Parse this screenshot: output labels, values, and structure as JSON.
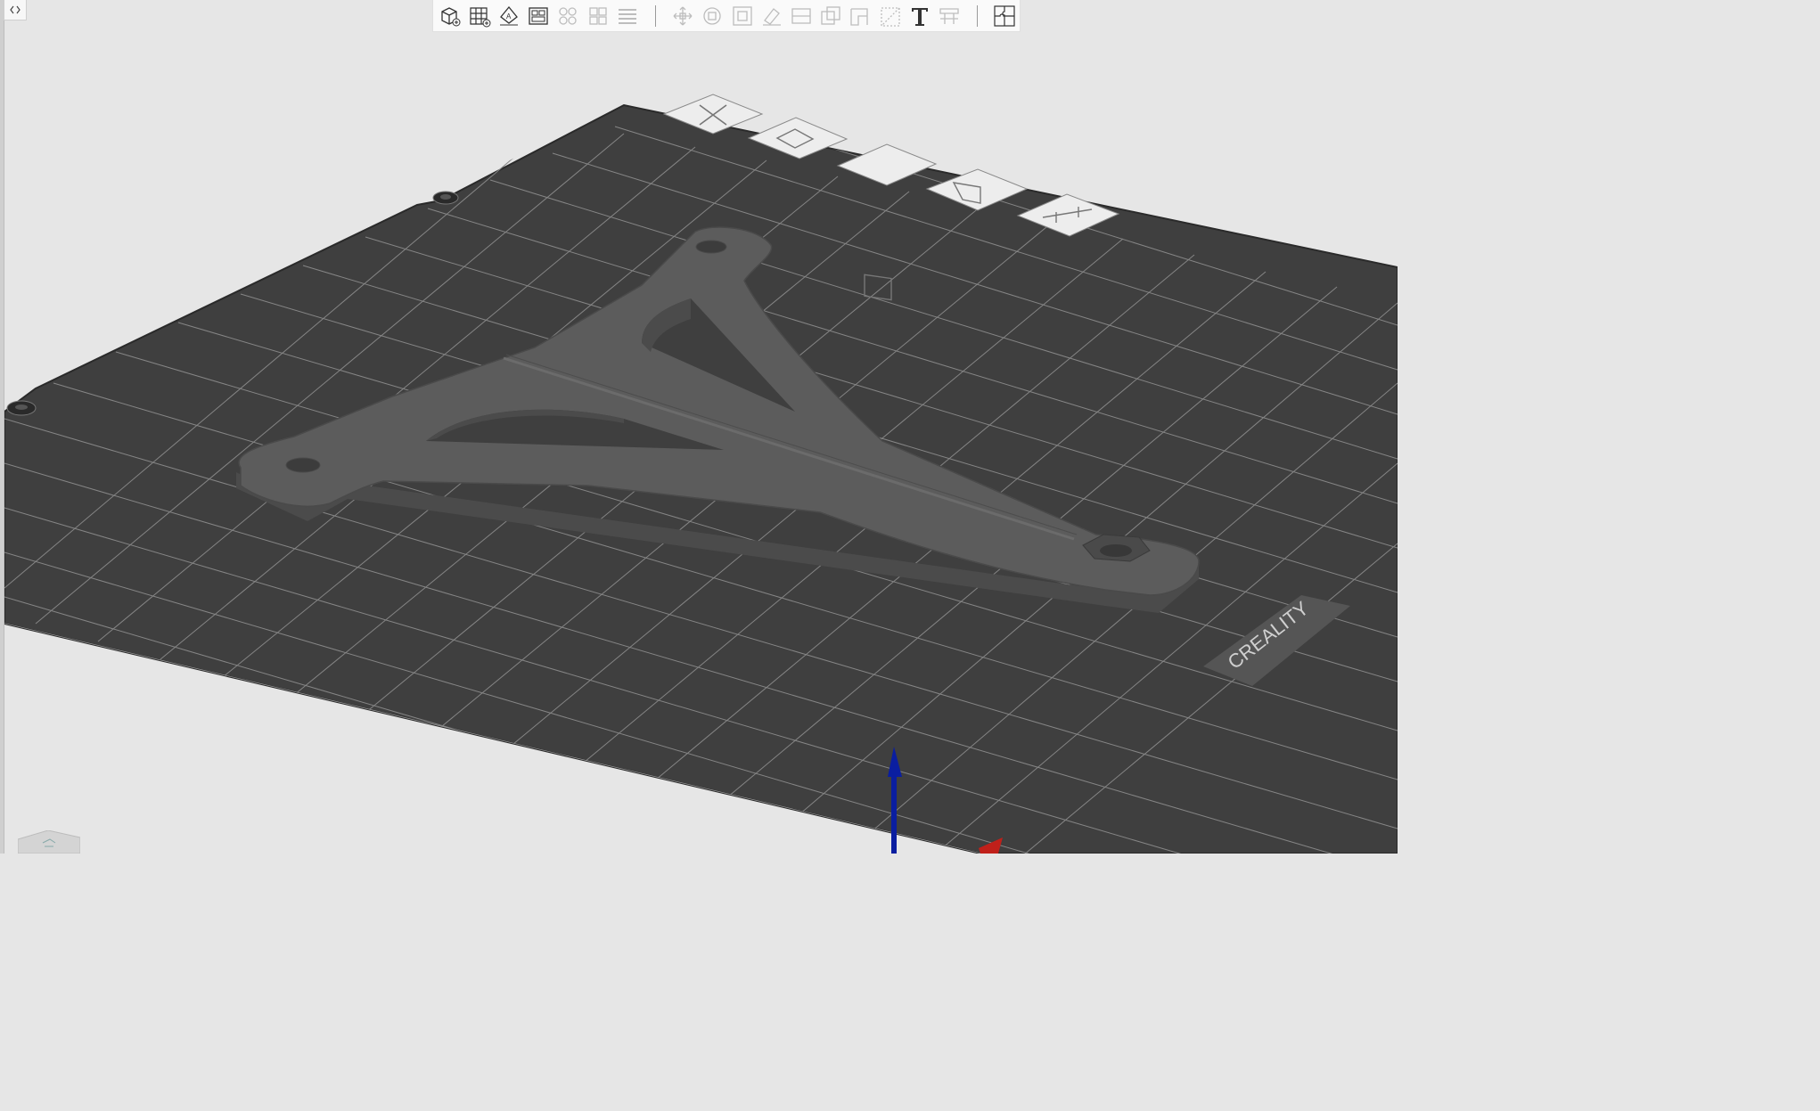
{
  "app": {
    "toolbar": {
      "groups": [
        [
          "add-object",
          "arrange-grid",
          "auto-orient",
          "split-plates"
        ],
        [
          "arrange-objects",
          "arrange-all",
          "layers"
        ],
        [
          "move",
          "rotate",
          "scale",
          "paint-support",
          "cut",
          "boolean",
          "seam-paint",
          "text-placement",
          "text",
          "measure"
        ],
        [
          "assembly"
        ]
      ],
      "enabled": [
        "add-object",
        "arrange-grid",
        "auto-orient",
        "split-plates",
        "text",
        "assembly"
      ]
    },
    "plate_tabs": [
      "close-plate",
      "auto-orient-plate",
      "arrange-plate",
      "lock-plate",
      "plate-settings"
    ],
    "bed": {
      "brand_logo": "CREALITY",
      "surface_color": "#3f3f3f",
      "grid_color": "#8a8a8a"
    },
    "model": {
      "color": "#5c5c5c",
      "shape": "Y-bracket"
    },
    "axes": {
      "z_color": "#0a1ea0",
      "x_color": "#c0201a"
    }
  }
}
